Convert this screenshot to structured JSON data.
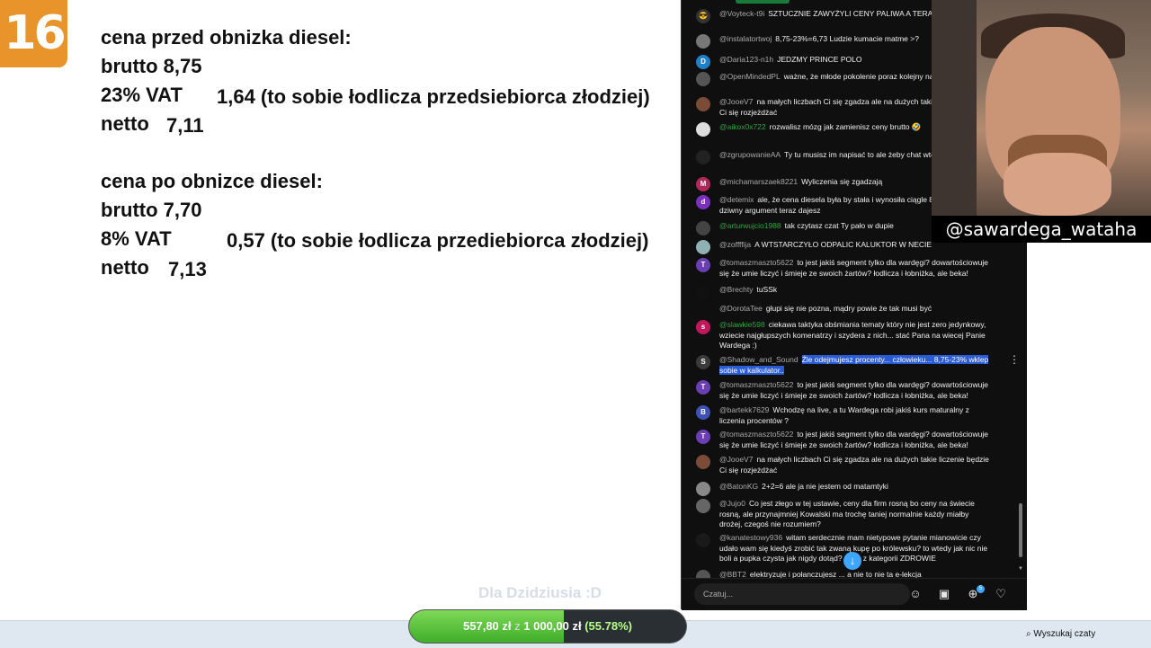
{
  "episode_badge": "16",
  "calc": {
    "before_heading": "cena przed obnizka diesel:",
    "before_gross": "brutto 8,75",
    "before_vat_label": "23% VAT",
    "before_vat_value": "1,64 (to sobie łodlicza przedsiebiorca złodziej)",
    "before_net_label": "netto",
    "before_net_value": "7,11",
    "after_heading": "cena po obnizce diesel:",
    "after_gross": "brutto 7,70",
    "after_vat_label": "8% VAT",
    "after_vat_value": "0,57 (to sobie łodlicza przediebiorca złodziej)",
    "after_net_label": "netto",
    "after_net_value": "7,13"
  },
  "chat": {
    "messages": [
      {
        "user": "@Voyteck-t9i",
        "text": "SZTUCZNIE ZAWYŻYLI CENY PALIWA A TERAZ BOHATER",
        "avatar": "😎",
        "color": "#333333"
      },
      {
        "user": "@instalatortwoj",
        "text": "8,75-23%=6,73 Ludzie kumacie matme >?",
        "avatar": "",
        "color": "#777777"
      },
      {
        "user": "@Daria123-n1h",
        "text": "JEDZMY PRINCE POLO",
        "avatar": "D",
        "color": "#1f7fc7"
      },
      {
        "user": "@OpenMindedPL",
        "text": "ważne, że młode pokolenie poraz kolejny na MŚ xD",
        "avatar": "",
        "color": "#555555"
      },
      {
        "user": "@JooeV7",
        "text": "na małych liczbach Ci się zgadza ale na dużych takie liczenie będzie Ci się rozjeżdżać",
        "avatar": "",
        "color": "#7a4b36"
      },
      {
        "user": "@aikox0x722",
        "text": "rozwalisz mózg jak zamienisz ceny brutto 🤣",
        "avatar": "",
        "color": "#dddddd",
        "green": true
      },
      {
        "user": "@zgrupowanieAA",
        "text": "Ty tu musisz im napisać to ale żeby chat wtedy uwierzą xd",
        "avatar": "",
        "color": "#222222"
      },
      {
        "user": "@michamarszaek8221",
        "text": "Wyliczenia się zgadzają",
        "avatar": "M",
        "color": "#b0285a"
      },
      {
        "user": "@detemix",
        "text": "ale, że cena diesela była by stała i wynosiła ciągle 8,75, a rosła? bo dziwny argument teraz dajesz",
        "avatar": "d",
        "color": "#7b2fbe"
      },
      {
        "user": "@arturwujcio1988",
        "text": "tak czytasz czat Ty pało w dupie",
        "avatar": "",
        "color": "#444444",
        "green": true
      },
      {
        "user": "@zoffffija",
        "text": "A WTSTARCZYŁO ODPALIC KALUKTOR W NECIE",
        "avatar": "",
        "color": "#8fb0b5"
      },
      {
        "user": "@tomaszmaszto5622",
        "text": "to jest jakiś segment tylko dla wardęgi? dowartościowuje się że umie liczyć i śmieje ze swoich żartów? łodlicza i łobniżka, ale beka!",
        "avatar": "T",
        "color": "#6a3fb5"
      },
      {
        "user": "@Brechty",
        "text": "tuSSk",
        "avatar": "",
        "color": "#111111"
      },
      {
        "user": "@DorotaTee",
        "text": "głupi się nie pozna, mądry powie że tak musi być",
        "avatar": "",
        "color": "#0f0f0f"
      },
      {
        "user": "@slawkie598",
        "text": "ciekawa taktyka obśmiania tematy który nie jest zero jedynkowy, wziecie najgłupszych komenatrzy i szydera z nich... stać Pana na wiecej Panie Wardega :)",
        "avatar": "s",
        "color": "#c2185b",
        "green": true
      },
      {
        "user": "@Shadow_and_Sound",
        "text": "Źle odejmujesz procenty... człowieku... 8,75-23% wklep sobie w kalkulator..",
        "avatar": "S",
        "color": "#3a3a3a",
        "highlight": true
      },
      {
        "user": "@tomaszmaszto5622",
        "text": "to jest jakiś segment tylko dla wardęgi? dowartościowuje się że umie liczyć i śmieje ze swoich żartów? łodlicza i łobniżka, ale beka!",
        "avatar": "T",
        "color": "#6a3fb5"
      },
      {
        "user": "@bartekk7629",
        "text": "Wchodzę na live, a tu Wardega robi jakiś kurs maturalny z liczenia procentów ?",
        "avatar": "B",
        "color": "#3f51b5"
      },
      {
        "user": "@tomaszmaszto5622",
        "text": "to jest jakiś segment tylko dla wardęgi? dowartościowuje się że umie liczyć i śmieje ze swoich żartów? łodlicza i łobniżka, ale beka!",
        "avatar": "T",
        "color": "#6a3fb5"
      },
      {
        "user": "@JooeV7",
        "text": "na małych liczbach Ci się zgadza ale na dużych takie liczenie będzie Ci się rozjeżdżać",
        "avatar": "",
        "color": "#7a4b36"
      },
      {
        "user": "@BatonKG",
        "text": "2+2=6 ale ja nie jestem od matamtyki",
        "avatar": "",
        "color": "#888888"
      },
      {
        "user": "@Jujo0",
        "text": "Co jest złego w tej ustawie, ceny dla firm rosną bo ceny na świecie rosną, ale przynajmniej Kowalski ma trochę taniej normalnie każdy miałby drożej, czegoś nie rozumiem?",
        "avatar": "",
        "color": "#666666"
      },
      {
        "user": "@kanatestowy936",
        "text": "witam serdecznie mam nietypowe pytanie mianowicie czy udało wam się kiedyś zrobić tak zwaną kupę po królewsku? to wtedy jak nic nie boli a pupka czysta jak nigdy dotąd? tanie z kategorii ZDROWIE",
        "avatar": "",
        "color": "#1a1a1a"
      },
      {
        "user": "@BBT2",
        "text": "elektryzuje i połanczujesz ... a nie to nie ta e-lekcja",
        "avatar": "",
        "color": "#555555"
      }
    ],
    "input_placeholder": "Czatuj...",
    "plus_badge": "5",
    "scroll_down_icon": "arrow-down-icon"
  },
  "webcam": {
    "handle": "@sawardega_wataha"
  },
  "donation": {
    "label": "Dla Dzidziusia :D",
    "current": "557,80 zł",
    "sep": "z",
    "goal": "1 000,00 zł",
    "percent_text": "(55.78%)",
    "percent": 55.78
  },
  "taskbar": {
    "search_chats": "Wyszukaj czaty"
  }
}
